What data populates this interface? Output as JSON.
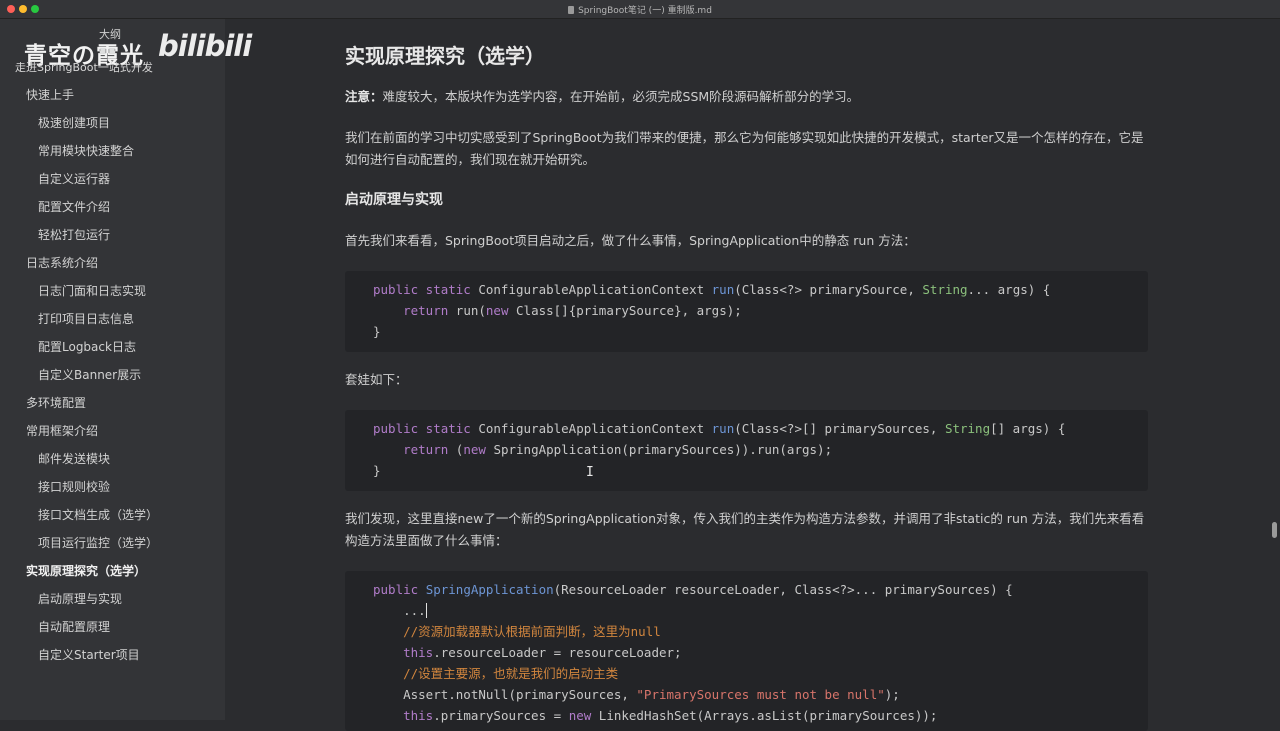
{
  "window": {
    "title": "SpringBoot笔记 (一) 重制版.md"
  },
  "overlay": {
    "brand": "青空の霞光",
    "brand_sub": "走进SpringBoot一站式开发",
    "outline_label": "大纲",
    "bili_logo": "bilibili"
  },
  "toc": [
    {
      "label": "快速上手",
      "level": 1
    },
    {
      "label": "极速创建项目",
      "level": 2
    },
    {
      "label": "常用模块快速整合",
      "level": 2
    },
    {
      "label": "自定义运行器",
      "level": 2
    },
    {
      "label": "配置文件介绍",
      "level": 2
    },
    {
      "label": "轻松打包运行",
      "level": 2
    },
    {
      "label": "日志系统介绍",
      "level": 1
    },
    {
      "label": "日志门面和日志实现",
      "level": 2
    },
    {
      "label": "打印项目日志信息",
      "level": 2
    },
    {
      "label": "配置Logback日志",
      "level": 2
    },
    {
      "label": "自定义Banner展示",
      "level": 2
    },
    {
      "label": "多环境配置",
      "level": 1
    },
    {
      "label": "常用框架介绍",
      "level": 1
    },
    {
      "label": "邮件发送模块",
      "level": 2
    },
    {
      "label": "接口规则校验",
      "level": 2
    },
    {
      "label": "接口文档生成（选学）",
      "level": 2
    },
    {
      "label": "项目运行监控（选学）",
      "level": 2
    },
    {
      "label": "实现原理探究（选学）",
      "level": 1,
      "active": true
    },
    {
      "label": "启动原理与实现",
      "level": 2
    },
    {
      "label": "自动配置原理",
      "level": 2
    },
    {
      "label": "自定义Starter项目",
      "level": 2
    }
  ],
  "doc": {
    "title": "实现原理探究（选学）",
    "note_label": "注意：",
    "note_text": "难度较大，本版块作为选学内容，在开始前，必须完成SSM阶段源码解析部分的学习。",
    "intro": "我们在前面的学习中切实感受到了SpringBoot为我们带来的便捷，那么它为何能够实现如此快捷的开发模式，starter又是一个怎样的存在，它是如何进行自动配置的，我们现在就开始研究。",
    "section_title": "启动原理与实现",
    "p_first": "首先我们来看看，SpringBoot项目启动之后，做了什么事情，SpringApplication中的静态 run 方法：",
    "p_nested": "套娃如下：",
    "p_found": "我们发现，这里直接new了一个新的SpringApplication对象，传入我们的主类作为构造方法参数，并调用了非static的 run 方法，我们先来看看构造方法里面做了什么事情：",
    "code1": [
      "public static ConfigurableApplicationContext run(Class<?> primarySource, String... args) {",
      "    return run(new Class[]{primarySource}, args);",
      "}"
    ],
    "code2": [
      "public static ConfigurableApplicationContext run(Class<?>[] primarySources, String[] args) {",
      "    return (new SpringApplication(primarySources)).run(args);",
      "}"
    ],
    "code3": [
      "public SpringApplication(ResourceLoader resourceLoader, Class<?>... primarySources) {",
      "    ...",
      "    //资源加载器默认根据前面判断，这里为null",
      "    this.resourceLoader = resourceLoader;",
      "    //设置主要源，也就是我们的启动主类",
      "    Assert.notNull(primarySources, \"PrimarySources must not be null\");",
      "    this.primarySources = new LinkedHashSet(Arrays.asList(primarySources));"
    ]
  },
  "colors": {
    "keyword": "#b07cc9",
    "function": "#6d95d4",
    "type": "#8bc07c",
    "comment": "#d0853e",
    "string": "#d7746a"
  }
}
